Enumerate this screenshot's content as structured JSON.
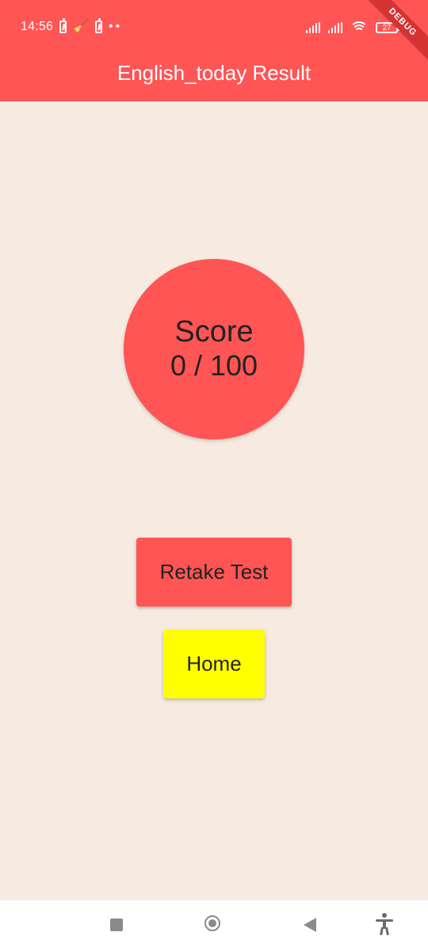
{
  "status_bar": {
    "time": "14:56",
    "battery_level": "27"
  },
  "debug_banner": {
    "label": "DEBUG"
  },
  "app_bar": {
    "title": "English_today Result"
  },
  "score": {
    "label": "Score",
    "value_text": "0 / 100",
    "value": 0,
    "max": 100
  },
  "actions": {
    "retake_label": "Retake Test",
    "home_label": "Home"
  },
  "nav_bar": {
    "icons": [
      "recents-icon",
      "home-icon",
      "back-icon",
      "accessibility-icon"
    ]
  },
  "colors": {
    "app_bar": "#ff5555",
    "background": "#f7ebe1",
    "score_circle": "#ff5555",
    "retake_button": "#ff5555",
    "home_button": "#ffff00"
  }
}
